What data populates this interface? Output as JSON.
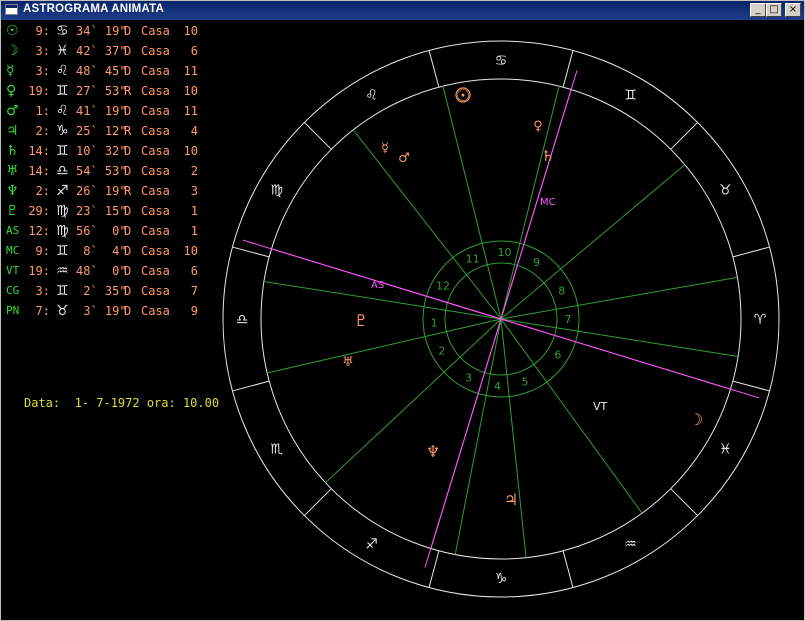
{
  "window": {
    "title": "ASTROGRAMA ANIMATA",
    "min_label": "_",
    "max_label": "□",
    "close_label": "×"
  },
  "planets": [
    {
      "code": "sun",
      "glyph": "☉",
      "deg": "9:",
      "sign": "♋",
      "mins": "34` 19\"",
      "motion": "D",
      "casa": "Casa",
      "house": "10"
    },
    {
      "code": "moon",
      "glyph": "☽",
      "deg": "3:",
      "sign": "♓",
      "mins": "42` 37\"",
      "motion": "D",
      "casa": "Casa",
      "house": "6"
    },
    {
      "code": "mercury",
      "glyph": "☿",
      "deg": "3:",
      "sign": "♌",
      "mins": "48` 45\"",
      "motion": "D",
      "casa": "Casa",
      "house": "11"
    },
    {
      "code": "venus",
      "glyph": "♀",
      "deg": "19:",
      "sign": "♊",
      "mins": "27` 53\"",
      "motion": "R",
      "casa": "Casa",
      "house": "10"
    },
    {
      "code": "mars",
      "glyph": "♂",
      "deg": "1:",
      "sign": "♌",
      "mins": "41` 19\"",
      "motion": "D",
      "casa": "Casa",
      "house": "11"
    },
    {
      "code": "jupiter",
      "glyph": "♃",
      "deg": "2:",
      "sign": "♑",
      "mins": "25` 12\"",
      "motion": "R",
      "casa": "Casa",
      "house": "4"
    },
    {
      "code": "saturn",
      "glyph": "♄",
      "deg": "14:",
      "sign": "♊",
      "mins": "10` 32\"",
      "motion": "D",
      "casa": "Casa",
      "house": "10"
    },
    {
      "code": "uranus",
      "glyph": "♅",
      "deg": "14:",
      "sign": "♎",
      "mins": "54` 53\"",
      "motion": "D",
      "casa": "Casa",
      "house": "2"
    },
    {
      "code": "neptune",
      "glyph": "♆",
      "deg": "2:",
      "sign": "♐",
      "mins": "26` 19\"",
      "motion": "R",
      "casa": "Casa",
      "house": "3"
    },
    {
      "code": "pluto",
      "glyph": "♇",
      "deg": "29:",
      "sign": "♍",
      "mins": "23` 15\"",
      "motion": "D",
      "casa": "Casa",
      "house": "1"
    },
    {
      "code": "AS",
      "glyph": "AS",
      "deg": "12:",
      "sign": "♍",
      "mins": "56`  0\"",
      "motion": "D",
      "casa": "Casa",
      "house": "1"
    },
    {
      "code": "MC",
      "glyph": "MC",
      "deg": "9:",
      "sign": "♊",
      "mins": " 8`  4\"",
      "motion": "D",
      "casa": "Casa",
      "house": "10"
    },
    {
      "code": "VT",
      "glyph": "VT",
      "deg": "19:",
      "sign": "♒",
      "mins": "48`  0\"",
      "motion": "D",
      "casa": "Casa",
      "house": "6"
    },
    {
      "code": "CG",
      "glyph": "CG",
      "deg": "3:",
      "sign": "♊",
      "mins": " 2` 35\"",
      "motion": "D",
      "casa": "Casa",
      "house": "7"
    },
    {
      "code": "PN",
      "glyph": "PN",
      "deg": "7:",
      "sign": "♉",
      "mins": " 3` 19\"",
      "motion": "D",
      "casa": "Casa",
      "house": "9"
    }
  ],
  "date_line": "Data:  1- 7-1972 ora: 10.00",
  "chart": {
    "zodiac_signs": [
      {
        "name": "aries-icon",
        "glyph": "♈"
      },
      {
        "name": "taurus-icon",
        "glyph": "♉"
      },
      {
        "name": "gemini-icon",
        "glyph": "♊"
      },
      {
        "name": "cancer-icon",
        "glyph": "♋"
      },
      {
        "name": "leo-icon",
        "glyph": "♌"
      },
      {
        "name": "virgo-icon",
        "glyph": "♍"
      },
      {
        "name": "libra-icon",
        "glyph": "♎"
      },
      {
        "name": "scorpio-icon",
        "glyph": "♏"
      },
      {
        "name": "sagittarius-icon",
        "glyph": "♐"
      },
      {
        "name": "capricorn-icon",
        "glyph": "♑"
      },
      {
        "name": "aquarius-icon",
        "glyph": "♒"
      },
      {
        "name": "pisces-icon",
        "glyph": "♓"
      }
    ],
    "house_numbers": [
      "1",
      "2",
      "3",
      "4",
      "5",
      "6",
      "7",
      "8",
      "9",
      "10",
      "11",
      "12"
    ],
    "axis_labels": {
      "as": "AS",
      "mc": "MC",
      "vt": "VT"
    },
    "colors": {
      "ring": "#e8e8e8",
      "house_line": "#2fa02f",
      "axis_line": "#ff55ff",
      "planet": "#ff9966",
      "text_green": "#33dd33",
      "date": "#dddd33"
    }
  }
}
